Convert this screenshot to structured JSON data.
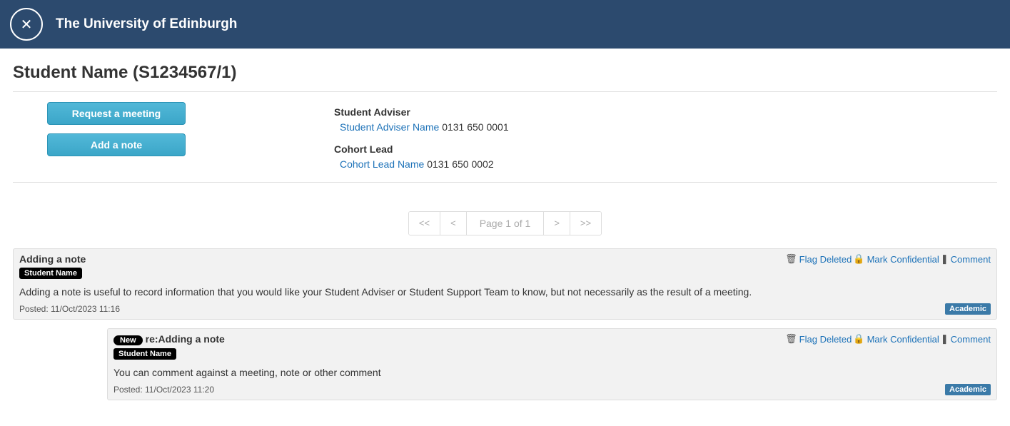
{
  "header": {
    "site_name": "The University of Edinburgh"
  },
  "page_title": "Student Name (S1234567/1)",
  "buttons": {
    "request_meeting": "Request a meeting",
    "add_note": "Add a note"
  },
  "contacts": {
    "adviser_label": "Student Adviser",
    "adviser_name": "Student Adviser Name",
    "adviser_phone": "0131 650 0001",
    "cohort_label": "Cohort Lead",
    "cohort_name": "Cohort Lead Name",
    "cohort_phone": "0131 650 0002"
  },
  "pager": {
    "first": "<<",
    "prev": "<",
    "label": "Page 1 of 1",
    "next": ">",
    "last": ">>"
  },
  "actions": {
    "flag_deleted": "Flag Deleted",
    "mark_confidential": "Mark Confidential",
    "comment": "Comment"
  },
  "notes": [
    {
      "new_badge": "",
      "title": "Adding a note",
      "author": "Student Name",
      "body": "Adding a note is useful to record information that you would like your Student Adviser or Student Support Team to know, but not necessarily as the result of a meeting.",
      "posted": "Posted: 11/Oct/2023 11:16",
      "tag": "Academic"
    },
    {
      "new_badge": "New",
      "title": "re:Adding a note",
      "author": "Student Name",
      "body": "You can comment against a meeting, note or other comment",
      "posted": "Posted: 11/Oct/2023 11:20",
      "tag": "Academic"
    }
  ]
}
